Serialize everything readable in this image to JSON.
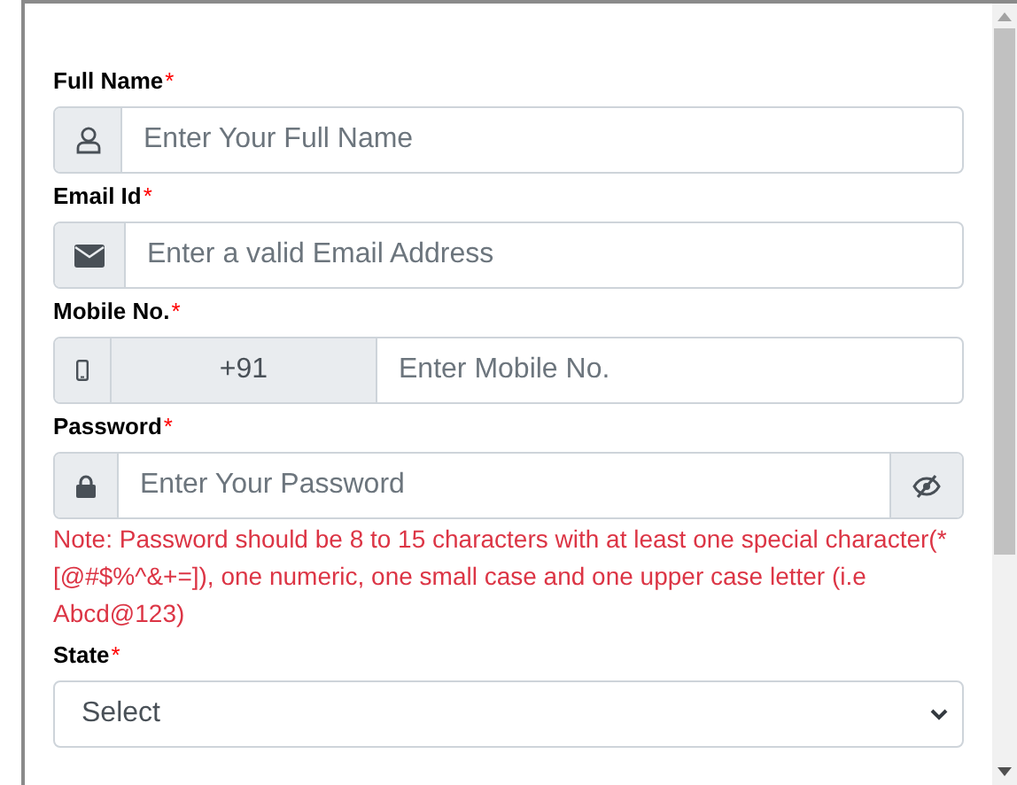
{
  "fields": [
    {
      "kind": "text",
      "label": "Full Name",
      "required_mark": "*",
      "placeholder": "Enter Your Full Name"
    },
    {
      "kind": "text",
      "label": "Email Id",
      "required_mark": "*",
      "placeholder": "Enter a valid Email Address"
    },
    {
      "kind": "phone",
      "label": "Mobile No.",
      "required_mark": "*",
      "prefix": "+91",
      "placeholder": "Enter Mobile No."
    },
    {
      "kind": "password",
      "label": "Password",
      "required_mark": "*",
      "placeholder": "Enter Your Password",
      "note": "Note: Password should be 8 to 15 characters with at least one special character(*[@#$%^&+=]), one numeric, one small case and one upper case letter (i.e Abcd@123)"
    },
    {
      "kind": "select",
      "label": "State",
      "required_mark": "*",
      "value": "Select"
    }
  ]
}
